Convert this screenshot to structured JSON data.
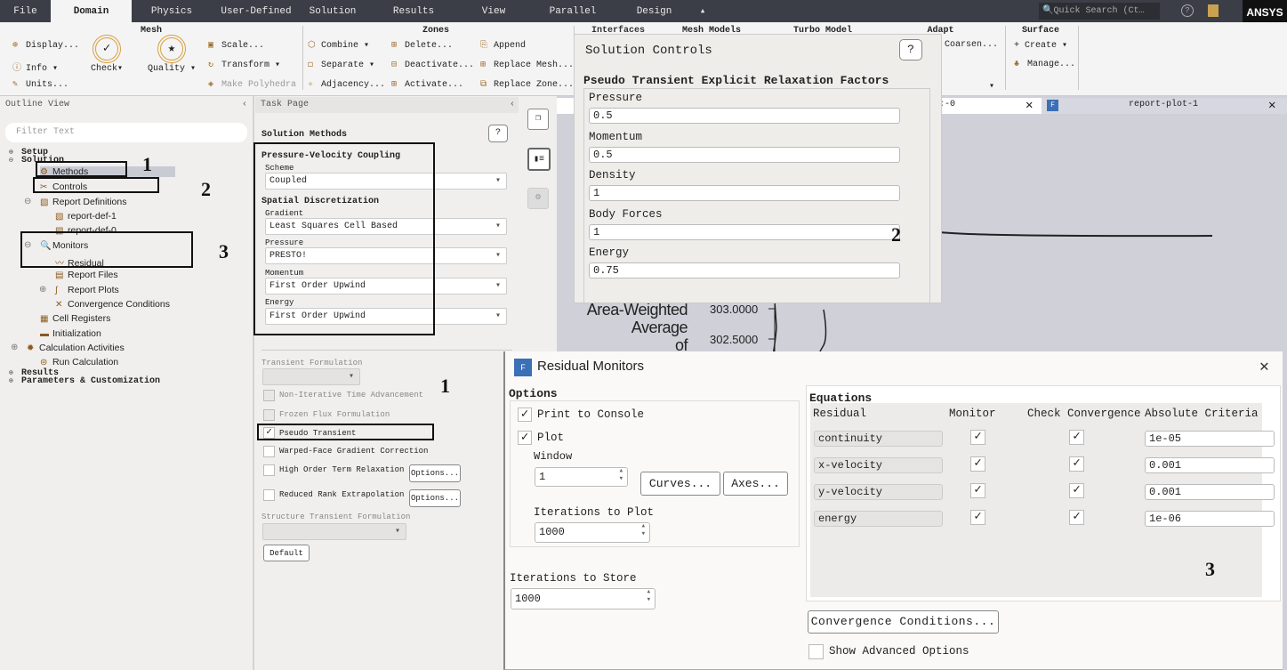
{
  "menu": {
    "tabs": [
      "File",
      "Domain",
      "Physics",
      "User-Defined",
      "Solution",
      "Results",
      "View",
      "Parallel",
      "Design"
    ],
    "active": "Domain",
    "search_placeholder": "Quick Search (Ct…",
    "brand": "ANSYS"
  },
  "ribbon": {
    "mesh": {
      "title": "Mesh",
      "display": "Display...",
      "info": "Info",
      "units": "Units...",
      "check": "Check",
      "quality": "Quality",
      "scale": "Scale...",
      "transform": "Transform",
      "make_polyhedra": "Make Polyhedra"
    },
    "zones": {
      "title": "Zones",
      "combine": "Combine",
      "separate": "Separate",
      "adjacency": "Adjacency...",
      "delete": "Delete...",
      "deactivate": "Deactivate...",
      "activate": "Activate...",
      "append": "Append",
      "replace_mesh": "Replace Mesh...",
      "replace_zone": "Replace Zone..."
    },
    "interfaces": {
      "title": "Interfaces"
    },
    "mesh_models": {
      "title": "Mesh Models"
    },
    "turbo_model": {
      "title": "Turbo Model"
    },
    "adapt": {
      "title": "Adapt",
      "coarsen": "Coarsen..."
    },
    "surface": {
      "title": "Surface",
      "create": "+ Create",
      "manage": "Manage..."
    }
  },
  "outline": {
    "title": "Outline View",
    "filter_placeholder": "Filter Text",
    "items": [
      {
        "label": "Setup",
        "level": 0,
        "mono": true,
        "toggle": "+"
      },
      {
        "label": "Solution",
        "level": 0,
        "mono": true,
        "toggle": "-"
      },
      {
        "label": "Methods",
        "level": 2,
        "icon": "methods-icon",
        "glyph": "⚙",
        "selected": true
      },
      {
        "label": "Controls",
        "level": 2,
        "icon": "controls-icon",
        "glyph": "✂"
      },
      {
        "label": "Report Definitions",
        "level": 2,
        "icon": "report-definitions-icon",
        "glyph": "▧",
        "toggle": "-"
      },
      {
        "label": "report-def-1",
        "level": 3,
        "icon": "report-def-icon",
        "glyph": "▧"
      },
      {
        "label": "report-def-0",
        "level": 3,
        "icon": "report-def-icon",
        "glyph": "▧"
      },
      {
        "label": "Monitors",
        "level": 2,
        "icon": "monitors-icon",
        "glyph": "🔍",
        "toggle": "-"
      },
      {
        "label": "Residual",
        "level": 3,
        "icon": "residual-icon",
        "glyph": "〰"
      },
      {
        "label": "Report Files",
        "level": 3,
        "icon": "report-files-icon",
        "glyph": "▤"
      },
      {
        "label": "Report Plots",
        "level": 3,
        "icon": "report-plots-icon",
        "glyph": "∫",
        "toggle": "+"
      },
      {
        "label": "Convergence Conditions",
        "level": 3,
        "icon": "convergence-icon",
        "glyph": "✕"
      },
      {
        "label": "Cell Registers",
        "level": 2,
        "icon": "cell-registers-icon",
        "glyph": "▦"
      },
      {
        "label": "Initialization",
        "level": 2,
        "icon": "initialization-icon",
        "glyph": "▬"
      },
      {
        "label": "Calculation Activities",
        "level": 1,
        "icon": "calculation-activities-icon",
        "glyph": "✹",
        "toggle": "+"
      },
      {
        "label": "Run Calculation",
        "level": 2,
        "icon": "run-calculation-icon",
        "glyph": "⊜"
      },
      {
        "label": "Results",
        "level": 0,
        "mono": true,
        "toggle": "+"
      },
      {
        "label": "Parameters & Customization",
        "level": 0,
        "mono": true,
        "toggle": "+"
      }
    ]
  },
  "task": {
    "title": "Task Page",
    "heading": "Solution Methods",
    "pv_title": "Pressure-Velocity Coupling",
    "scheme_label": "Scheme",
    "scheme": "Coupled",
    "sd_title": "Spatial Discretization",
    "gradient_label": "Gradient",
    "gradient": "Least Squares Cell Based",
    "pressure_label": "Pressure",
    "pressure": "PRESTO!",
    "momentum_label": "Momentum",
    "momentum": "First Order Upwind",
    "energy_label": "Energy",
    "energy": "First Order Upwind",
    "transient_label": "Transient Formulation",
    "opt_nita": "Non-Iterative Time Advancement",
    "opt_frozen": "Frozen Flux Formulation",
    "opt_pseudo": "Pseudo Transient",
    "pseudo_checked": true,
    "opt_warped": "Warped-Face Gradient Correction",
    "opt_hotr": "High Order Term Relaxation",
    "opt_rre": "Reduced Rank Extrapolation",
    "options_btn": "Options...",
    "structure_label": "Structure Transient Formulation",
    "default_btn": "Default"
  },
  "graphics": {
    "tab1": "report-plot-0",
    "tab1_visible": ":-0",
    "tab2": "report-plot-1",
    "ylabel": [
      "Area-Weighted",
      "Average",
      "of"
    ],
    "ticks": [
      "303.0000",
      "302.5000"
    ]
  },
  "solution_controls": {
    "title": "Solution Controls",
    "section": "Pseudo Transient Explicit Relaxation Factors",
    "fields": [
      {
        "label": "Pressure",
        "value": "0.5"
      },
      {
        "label": "Momentum",
        "value": "0.5"
      },
      {
        "label": "Density",
        "value": "1"
      },
      {
        "label": "Body Forces",
        "value": "1"
      },
      {
        "label": "Energy",
        "value": "0.75"
      }
    ]
  },
  "residual": {
    "title": "Residual Monitors",
    "options_title": "Options",
    "print_console": "Print to Console",
    "plot": "Plot",
    "window_label": "Window",
    "window": "1",
    "curves_btn": "Curves...",
    "axes_btn": "Axes...",
    "iter_plot_label": "Iterations to Plot",
    "iter_plot": "1000",
    "iter_store_label": "Iterations to Store",
    "iter_store": "1000",
    "equations_title": "Equations",
    "headers": [
      "Residual",
      "Monitor",
      "Check Convergence",
      "Absolute Criteria"
    ],
    "rows": [
      {
        "name": "continuity",
        "criteria": "1e-05"
      },
      {
        "name": "x-velocity",
        "criteria": "0.001"
      },
      {
        "name": "y-velocity",
        "criteria": "0.001"
      },
      {
        "name": "energy",
        "criteria": "1e-06"
      }
    ],
    "convergence_btn": "Convergence Conditions...",
    "advanced": "Show Advanced Options"
  },
  "annotations": {
    "n1": "1",
    "n2": "2",
    "n3": "3"
  },
  "colors": {
    "menubar": "#3b3e46",
    "accent": "#3b6fb6",
    "graphics_bg": "#cfd0d8"
  }
}
